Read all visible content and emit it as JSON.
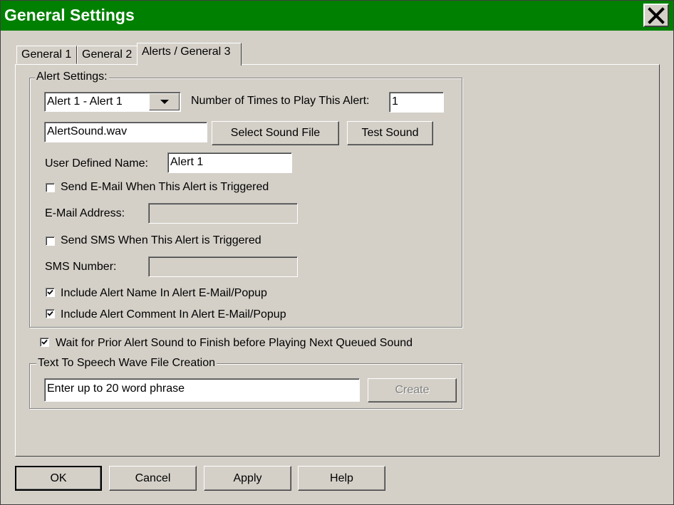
{
  "window": {
    "title": "General Settings",
    "title_bar_color": "#008000",
    "close_icon": "close-icon"
  },
  "tabs": [
    {
      "label": "General 1",
      "active": false
    },
    {
      "label": "General 2",
      "active": false
    },
    {
      "label": "Alerts / General 3",
      "active": true
    }
  ],
  "alert_settings": {
    "group_label": "Alert Settings:",
    "alert_select": {
      "value": "Alert 1 - Alert 1",
      "icon": "chevron-down-icon"
    },
    "times_label": "Number of Times to Play This Alert:",
    "times_value": "1",
    "sound_file_value": "AlertSound.wav",
    "select_sound_label": "Select Sound File",
    "test_sound_label": "Test Sound",
    "user_defined_label": "User Defined Name:",
    "user_defined_value": "Alert 1",
    "send_email_label": "Send E-Mail When This Alert is Triggered",
    "send_email_checked": false,
    "email_label": "E-Mail Address:",
    "email_value": "",
    "send_sms_label": "Send SMS When This Alert is Triggered",
    "send_sms_checked": false,
    "sms_label": "SMS Number:",
    "sms_value": "",
    "include_name_label": "Include Alert Name In Alert E-Mail/Popup",
    "include_name_checked": true,
    "include_comment_label": "Include Alert Comment In Alert E-Mail/Popup",
    "include_comment_checked": true
  },
  "wait_prior": {
    "label": "Wait for Prior Alert Sound to Finish before Playing Next Queued Sound",
    "checked": true
  },
  "tts": {
    "group_label": "Text To Speech Wave File Creation",
    "phrase_value": "Enter up to 20 word phrase",
    "create_label": "Create"
  },
  "footer": {
    "ok_label": "OK",
    "cancel_label": "Cancel",
    "apply_label": "Apply",
    "help_label": "Help"
  }
}
